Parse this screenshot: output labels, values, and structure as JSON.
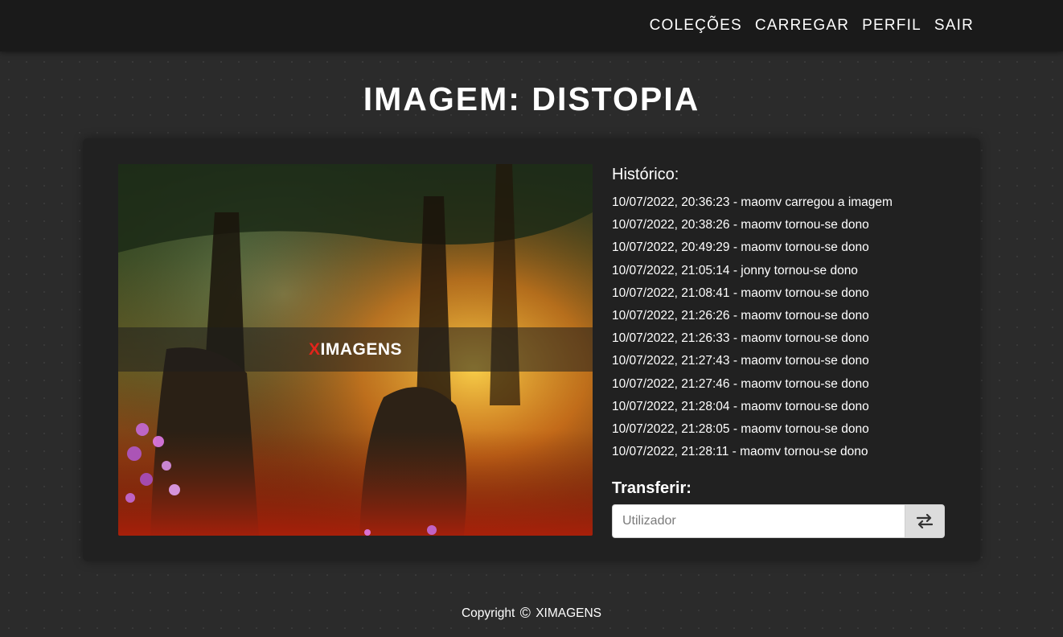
{
  "nav": {
    "items": [
      {
        "label": "COLEÇÕES"
      },
      {
        "label": "CARREGAR"
      },
      {
        "label": "PERFIL"
      },
      {
        "label": "SAIR"
      }
    ]
  },
  "page": {
    "title": "IMAGEM: DISTOPIA"
  },
  "image": {
    "watermark_x": "X",
    "watermark_rest": "IMAGENS"
  },
  "history": {
    "title": "Histórico:",
    "entries": [
      "10/07/2022, 20:36:23 - maomv carregou a imagem",
      "10/07/2022, 20:38:26 - maomv tornou-se dono",
      "10/07/2022, 20:49:29 - maomv tornou-se dono",
      "10/07/2022, 21:05:14 - jonny tornou-se dono",
      "10/07/2022, 21:08:41 - maomv tornou-se dono",
      "10/07/2022, 21:26:26 - maomv tornou-se dono",
      "10/07/2022, 21:26:33 - maomv tornou-se dono",
      "10/07/2022, 21:27:43 - maomv tornou-se dono",
      "10/07/2022, 21:27:46 - maomv tornou-se dono",
      "10/07/2022, 21:28:04 - maomv tornou-se dono",
      "10/07/2022, 21:28:05 - maomv tornou-se dono",
      "10/07/2022, 21:28:11 - maomv tornou-se dono"
    ]
  },
  "transfer": {
    "title": "Transferir:",
    "placeholder": "Utilizador",
    "value": "",
    "button_icon": "swap-arrows-icon"
  },
  "footer": {
    "prefix": "Copyright",
    "symbol": "©",
    "brand": "XIMAGENS"
  },
  "colors": {
    "background": "#2b2b2b",
    "navbar": "#1a1a1a",
    "card": "#212121",
    "watermark_accent": "#e3241b",
    "button": "#dcdcdc"
  }
}
